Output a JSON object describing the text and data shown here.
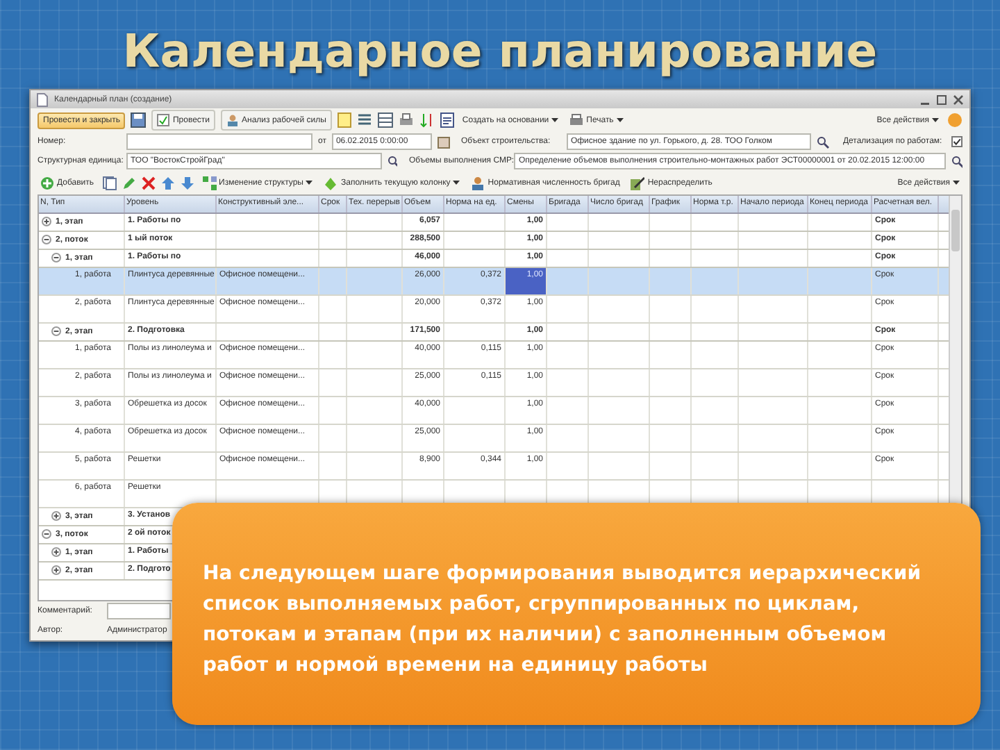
{
  "slide_title": "Календарное планирование",
  "window": {
    "title": "Календарный план (создание)"
  },
  "toolbar": {
    "post_close": "Провести и закрыть",
    "post": "Провести",
    "workforce": "Анализ рабочей силы",
    "create_based": "Создать на основании",
    "print": "Печать",
    "all_actions": "Все действия"
  },
  "form": {
    "number_label": "Номер:",
    "date_label": "от",
    "date": "06.02.2015 0:00:00",
    "object_label": "Объект строительства:",
    "object": "Офисное здание по ул. Горького, д. 28. ТОО Голком",
    "detail_label": "Детализация по работам:",
    "detail_checked": true,
    "unit_label": "Структурная единица:",
    "unit": "ТОО \"ВостокСтройГрад\"",
    "volumes_label": "Объемы выполнения СМР:",
    "volumes": "Определение объемов выполнения строительно-монтажных работ ЭСТ00000001 от 20.02.2015 12:00:00"
  },
  "table_toolbar": {
    "add": "Добавить",
    "structure": "Изменение структуры",
    "fill": "Заполнить текущую колонку",
    "brigades": "Нормативная численность бригад",
    "undistribute": "Нераспределить",
    "all_actions": "Все действия"
  },
  "table": {
    "columns": [
      "N, Тип",
      "Уровень",
      "Конструктивный эле...",
      "Срок",
      "Тех. перерыв",
      "Объем",
      "Норма на ед.",
      "Смены",
      "Бригада",
      "Число бригад",
      "График",
      "Норма т.р.",
      "Начало периода",
      "Конец периода",
      "Расчетная вел."
    ],
    "rows": [
      {
        "type": "1, этап",
        "level": "1. Работы по",
        "volume": "6,057",
        "shifts": "1,00",
        "calc": "Срок",
        "expanded": false,
        "selected": false
      },
      {
        "type": "2, поток",
        "level": "1 ый поток",
        "volume": "288,500",
        "shifts": "1,00",
        "calc": "Срок",
        "expanded": true,
        "selected": false,
        "children": [
          {
            "type": "1, этап",
            "level": "1. Работы по",
            "volume": "46,000",
            "shifts": "1,00",
            "calc": "Срок",
            "expanded": true,
            "selected": false,
            "children": [
              {
                "type": "1, работа",
                "level": "Плинтуса деревянные",
                "element": "Офисное помещени...",
                "volume": "26,000",
                "norm": "0,372",
                "shifts": "1,00",
                "calc": "Срок",
                "selected": true
              },
              {
                "type": "2, работа",
                "level": "Плинтуса деревянные",
                "element": "Офисное помещени...",
                "volume": "20,000",
                "norm": "0,372",
                "shifts": "1,00",
                "calc": "Срок",
                "selected": false
              }
            ]
          },
          {
            "type": "2, этап",
            "level": "2. Подготовка",
            "volume": "171,500",
            "shifts": "1,00",
            "calc": "Срок",
            "expanded": true,
            "selected": false,
            "children": [
              {
                "type": "1, работа",
                "level": "Полы из линолеума и",
                "element": "Офисное помещени...",
                "volume": "40,000",
                "norm": "0,115",
                "shifts": "1,00",
                "calc": "Срок",
                "selected": false
              },
              {
                "type": "2, работа",
                "level": "Полы из линолеума и",
                "element": "Офисное помещени...",
                "volume": "25,000",
                "norm": "0,115",
                "shifts": "1,00",
                "calc": "Срок",
                "selected": false
              },
              {
                "type": "3, работа",
                "level": "Обрешетка из досок",
                "element": "Офисное помещени...",
                "volume": "40,000",
                "shifts": "1,00",
                "calc": "Срок",
                "selected": false
              },
              {
                "type": "4, работа",
                "level": "Обрешетка из досок",
                "element": "Офисное помещени...",
                "volume": "25,000",
                "shifts": "1,00",
                "calc": "Срок",
                "selected": false
              },
              {
                "type": "5, работа",
                "level": "Решетки",
                "element": "Офисное помещени...",
                "volume": "8,900",
                "norm": "0,344",
                "shifts": "1,00",
                "calc": "Срок",
                "selected": false
              },
              {
                "type": "6, работа",
                "level": "Решетки",
                "selected": false
              }
            ]
          },
          {
            "type": "3, этап",
            "level": "3. Установ",
            "expanded": false,
            "selected": false
          }
        ]
      },
      {
        "type": "3, поток",
        "level": "2 ой поток",
        "expanded": true,
        "selected": false,
        "children": [
          {
            "type": "1, этап",
            "level": "1. Работы",
            "expanded": false,
            "selected": false
          },
          {
            "type": "2, этап",
            "level": "2. Подгото",
            "expanded": false,
            "selected": false
          }
        ]
      }
    ]
  },
  "footer": {
    "comment_label": "Комментарий:",
    "author_label": "Автор:",
    "author": "Администратор"
  },
  "callout": "На следующем шаге формирования выводится иерархический список выполняемых работ, сгруппированных по циклам, потокам и этапам (при их наличии) с заполненным объемом работ и нормой времени на единицу работы"
}
